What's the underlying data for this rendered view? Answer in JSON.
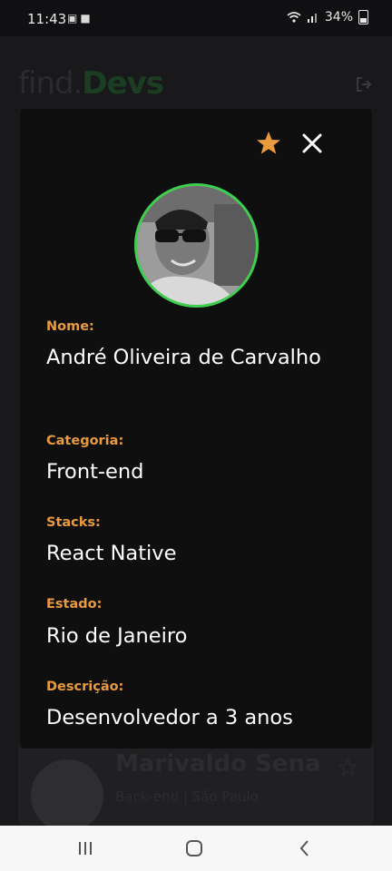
{
  "status": {
    "time": "11:43",
    "battery": "34%"
  },
  "background": {
    "logo_find": "find.",
    "logo_devs": "Devs",
    "card_name": "Marivaldo Sena",
    "card_subtitle": "Back-end | São Paulo"
  },
  "modal": {
    "fields": [
      {
        "label": "Nome:",
        "value": "André Oliveira de Carvalho"
      },
      {
        "label": "Categoria:",
        "value": "Front-end"
      },
      {
        "label": "Stacks:",
        "value": "React Native"
      },
      {
        "label": "Estado:",
        "value": "Rio de Janeiro"
      },
      {
        "label": "Descrição:",
        "value": "Desenvolvedor a 3 anos"
      }
    ],
    "favorite": true
  },
  "colors": {
    "accent_orange": "#ea9a3e",
    "avatar_ring": "#3ecf4e",
    "modal_bg": "#0f0f10"
  },
  "icons": [
    "star-icon",
    "close-icon",
    "logout-icon",
    "recents-icon",
    "home-icon",
    "back-icon"
  ]
}
